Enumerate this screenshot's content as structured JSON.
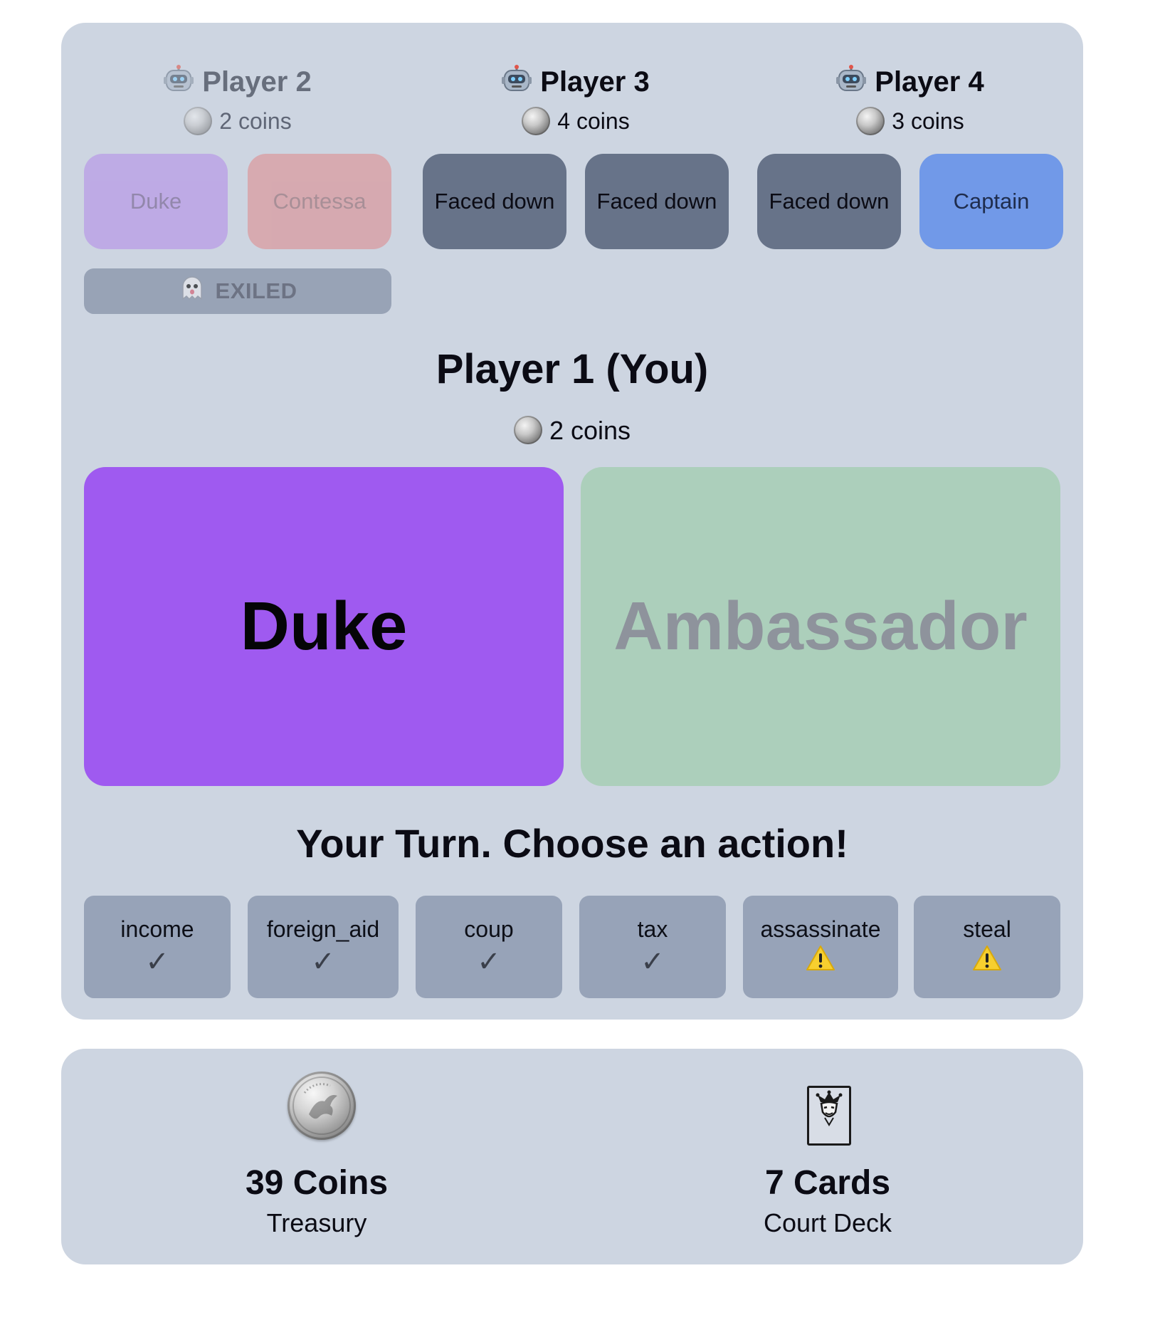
{
  "opponents": [
    {
      "name": "Player 2",
      "icon": "robot-icon",
      "coins": "2 coins",
      "cards": [
        "Duke",
        "Contessa"
      ],
      "exiled": true,
      "exiled_label": "EXILED"
    },
    {
      "name": "Player 3",
      "icon": "robot-icon",
      "coins": "4 coins",
      "cards": [
        "Faced down",
        "Faced down"
      ],
      "exiled": false
    },
    {
      "name": "Player 4",
      "icon": "robot-icon",
      "coins": "3 coins",
      "cards": [
        "Faced down",
        "Captain"
      ],
      "exiled": false
    }
  ],
  "you": {
    "title": "Player 1 (You)",
    "coins": "2 coins",
    "cards": [
      "Duke",
      "Ambassador"
    ]
  },
  "turn": {
    "prompt": "Your Turn. Choose an action!",
    "actions": [
      {
        "label": "income",
        "status": "check"
      },
      {
        "label": "foreign_aid",
        "status": "check"
      },
      {
        "label": "coup",
        "status": "check"
      },
      {
        "label": "tax",
        "status": "check"
      },
      {
        "label": "assassinate",
        "status": "warning"
      },
      {
        "label": "steal",
        "status": "warning"
      }
    ]
  },
  "bank": {
    "treasury_value": "39 Coins",
    "treasury_label": "Treasury",
    "deck_value": "7 Cards",
    "deck_label": "Court Deck"
  },
  "colors": {
    "panel": "#cdd5e1",
    "duke": "#9f5af0",
    "ambassador": "#accfbb",
    "contessa": "#d8a5ab",
    "captain": "#7199e8",
    "faced_down": "#677389",
    "action_button": "#97a3b8"
  }
}
